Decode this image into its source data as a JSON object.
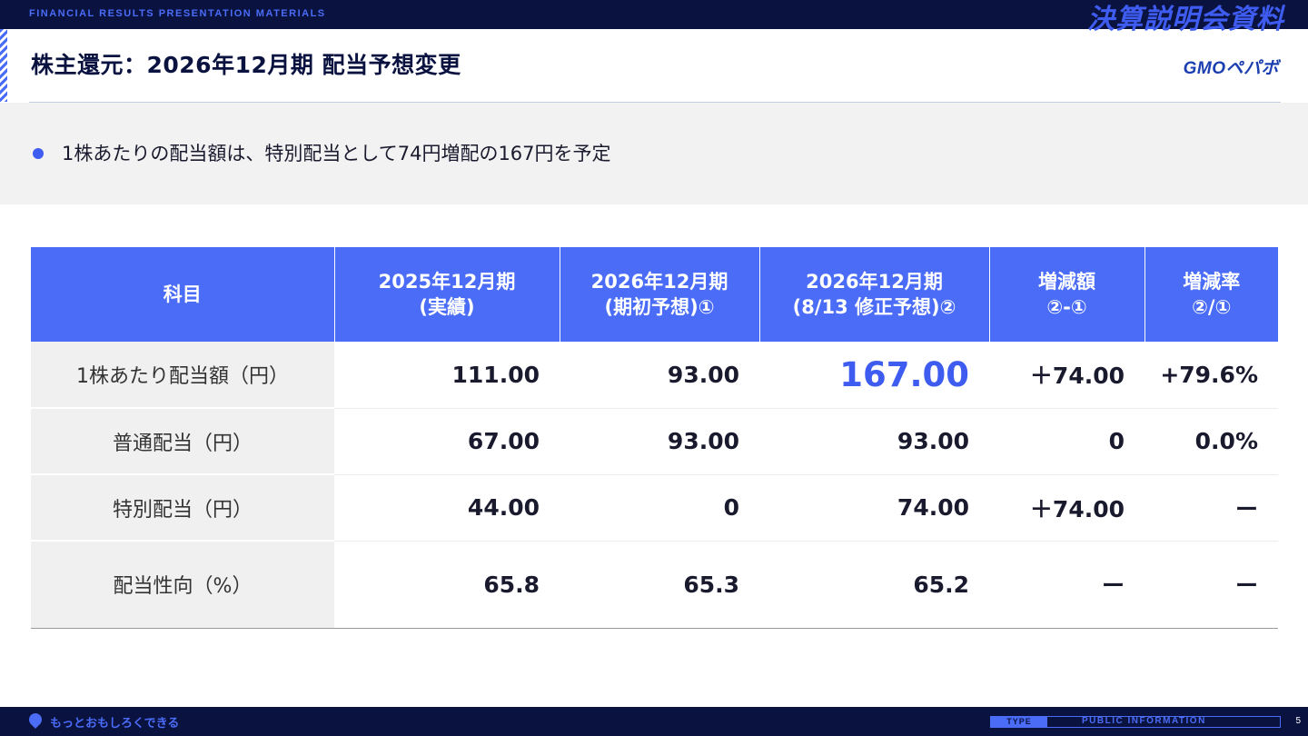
{
  "header": {
    "tag": "FINANCIAL RESULTS PRESENTATION MATERIALS",
    "jp_title": "決算説明会資料"
  },
  "slide": {
    "title": "株主還元：2026年12月期 配当予想変更",
    "logo": "GMOペパボ",
    "summary": "1株あたりの配当額は、特別配当として74円増配の167円を予定"
  },
  "table": {
    "headers": [
      [
        "科目",
        ""
      ],
      [
        "2025年12月期",
        "(実績)"
      ],
      [
        "2026年12月期",
        "(期初予想)①"
      ],
      [
        "2026年12月期",
        "(8/13 修正予想)②"
      ],
      [
        "増減額",
        "②-①"
      ],
      [
        "増減率",
        "②/①"
      ]
    ],
    "rows": [
      {
        "label": "1株あたり配当額（円）",
        "values": [
          "111.00",
          "93.00",
          "167.00",
          "＋74.00",
          "+79.6%"
        ]
      },
      {
        "label": "普通配当（円）",
        "values": [
          "67.00",
          "93.00",
          "93.00",
          "0",
          "0.0%"
        ]
      },
      {
        "label": "特別配当（円）",
        "values": [
          "44.00",
          "0",
          "74.00",
          "＋74.00",
          "ー"
        ]
      },
      {
        "label": "配当性向（%）",
        "values": [
          "65.8",
          "65.3",
          "65.2",
          "ー",
          "ー"
        ]
      }
    ]
  },
  "footer": {
    "slogan": "もっとおもしろくできる",
    "type_label": "TYPE",
    "type_value": "PUBLIC INFORMATION",
    "page": "5"
  },
  "colors": {
    "navy": "#0a1240",
    "accent": "#4a6cf7",
    "highlight": "#3e5cf0"
  }
}
